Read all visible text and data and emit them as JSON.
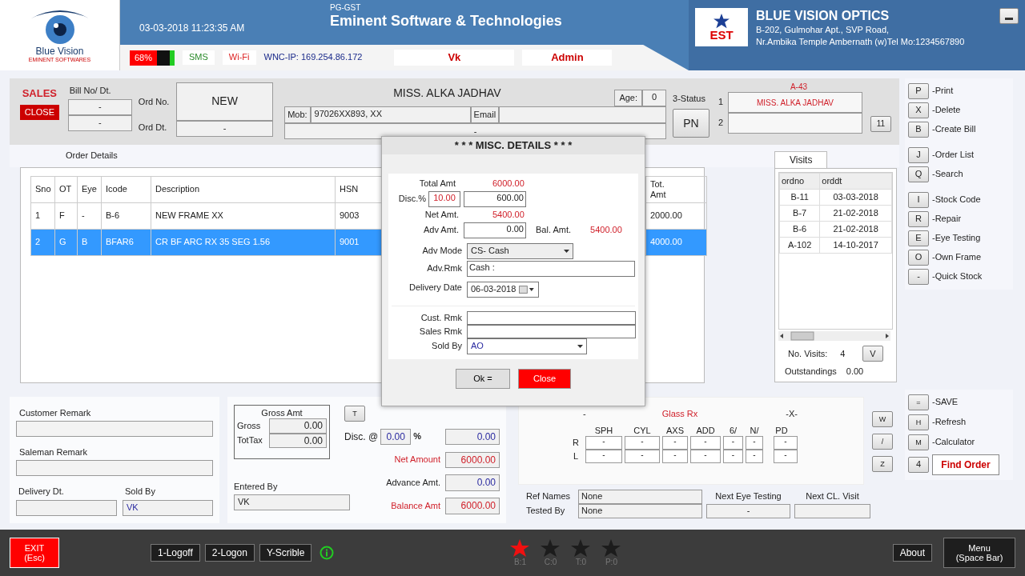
{
  "header": {
    "logo_text": "Blue Vision",
    "logo_subtext": "EMINENT SOFTWARES",
    "datetime": "03-03-2018 11:23:35 AM",
    "product": "PG-GST",
    "company": "Eminent Software  & Technologies",
    "battery": {
      "label": "68%",
      "level": 0.68
    },
    "sms": "SMS",
    "wifi": "Wi-Fi",
    "ip": "WNC-IP: 169.254.86.172",
    "user": "Vk",
    "role": "Admin",
    "shop_logo": "EST",
    "shop_name": "BLUE VISION OPTICS",
    "address_1": "B-202, Gulmohar Apt., SVP Road,",
    "address_2": "Nr.Ambika Temple Ambernath (w)Tel Mo:1234567890"
  },
  "order": {
    "mode": "SALES",
    "close": "CLOSE",
    "bill_label": "Bill No/ Dt.",
    "bill_no": "-",
    "bill_dt": "-",
    "ord_no_label": "Ord No.",
    "ord_no": "NEW",
    "ord_dt_label": "Ord Dt.",
    "ord_dt": "-",
    "customer": "MISS.  ALKA JADHAV",
    "age_label": "Age:",
    "age": "0",
    "mob_label": "Mob:",
    "mob": "97026XX893, XX",
    "email_label": "Email",
    "address": "-",
    "status_label": "3-Status",
    "status": "PN",
    "ref_code": "A-43",
    "slot_1": "1",
    "slot_1_value": "MISS.  ALKA JADHAV",
    "slot_2": "2",
    "count": "11"
  },
  "order_details_label": "Order Details",
  "items": {
    "columns": [
      "Sno",
      "OT",
      "Eye",
      "Icode",
      "Description",
      "HSN",
      "Tot. Amt"
    ],
    "rows": [
      {
        "cells": [
          "1",
          "F",
          "-",
          "B-6",
          "NEW FRAME XX",
          "9003",
          "2000.00"
        ],
        "selected": false
      },
      {
        "cells": [
          "2",
          "G",
          "B",
          "BFAR6",
          "CR BF ARC RX 35 SEG 1.56",
          "9001",
          "4000.00"
        ],
        "selected": true
      }
    ]
  },
  "visits": {
    "tab": "Visits",
    "columns": [
      "ordno",
      "orddt"
    ],
    "rows": [
      [
        "B-11",
        "03-03-2018"
      ],
      [
        "B-7",
        "21-02-2018"
      ],
      [
        "B-6",
        "21-02-2018"
      ],
      [
        "A-102",
        "14-10-2017"
      ]
    ],
    "count_label": "No. Visits:",
    "count": "4",
    "button": "V",
    "outstanding_label": "Outstandings",
    "outstanding": "0.00"
  },
  "shortcut_groups": [
    [
      {
        "key": "P",
        "label": "-Print"
      },
      {
        "key": "X",
        "label": "-Delete"
      },
      {
        "key": "B",
        "label": "-Create Bill"
      }
    ],
    [
      {
        "key": "J",
        "label": "-Order List"
      },
      {
        "key": "Q",
        "label": "-Search"
      }
    ],
    [
      {
        "key": "I",
        "label": "-Stock Code"
      },
      {
        "key": "R",
        "label": "-Repair"
      },
      {
        "key": "E",
        "label": "-Eye Testing"
      },
      {
        "key": "O",
        "label": "-Own Frame"
      },
      {
        "key": "-",
        "label": "-Quick Stock"
      }
    ]
  ],
  "remarks": {
    "customer_remark_label": "Customer Remark",
    "saleman_remark_label": "Saleman Remark",
    "delivery_label": "Delivery Dt.",
    "sold_by_label": "Sold By",
    "sold_by": "VK"
  },
  "amounts": {
    "gross_title": "Gross Amt",
    "gross_label": "Gross",
    "gross": "0.00",
    "tottax_label": "TotTax",
    "tottax": "0.00",
    "t_button": "T",
    "disc_label": "Disc. @",
    "disc_pct": "0.00",
    "pct": "%",
    "disc_amt": "0.00",
    "net_label": "Net Amount",
    "net": "6000.00",
    "advance_label": "Advance Amt.",
    "advance": "0.00",
    "balance_label": "Balance Amt",
    "balance": "6000.00",
    "entered_by_label": "Entered  By",
    "entered_by": "VK"
  },
  "rx": {
    "dash": "-",
    "title": "Glass Rx",
    "x_mark": "-X-",
    "columns": [
      "SPH",
      "CYL",
      "AXS",
      "ADD",
      "6/",
      "N/",
      "PD"
    ],
    "rows": [
      {
        "eye": "R",
        "values": [
          "-",
          "-",
          "-",
          "-",
          "-",
          "-",
          "-"
        ]
      },
      {
        "eye": "L",
        "values": [
          "-",
          "-",
          "-",
          "-",
          "-",
          "-",
          "-"
        ]
      }
    ],
    "side_buttons": [
      "W",
      "/",
      "Z"
    ],
    "ref_label": "Ref Names",
    "ref": "None",
    "tested_label": "Tested By",
    "tested": "None",
    "next_eye_label": "Next Eye Testing",
    "next_eye": "-",
    "next_cl_label": "Next CL. Visit"
  },
  "save_shortcuts": [
    {
      "key": "=",
      "label": "-SAVE"
    },
    {
      "key": "H",
      "label": "-Refresh"
    },
    {
      "key": "M",
      "label": "-Calculator"
    }
  ],
  "find": {
    "key": "4",
    "label": "Find Order"
  },
  "dialog": {
    "title": "* * *  MISC. DETAILS  * * *",
    "total_label": "Total Amt",
    "total": "6000.00",
    "disc_label": "Disc.%",
    "disc_pct": "10.00",
    "disc_amt": "600.00",
    "net_label": "Net Amt.",
    "net": "5400.00",
    "adv_label": "Adv Amt.",
    "adv": "0.00",
    "bal_label": "Bal. Amt.",
    "bal": "5400.00",
    "mode_label": "Adv Mode",
    "mode": "CS- Cash",
    "rmk_label": "Adv.Rmk",
    "rmk": "Cash :",
    "delivery_label": "Delivery Date",
    "delivery": "06-03-2018",
    "cust_rmk_label": "Cust. Rmk",
    "sales_rmk_label": "Sales Rmk",
    "sold_by_label": "Sold By",
    "sold_by": "AO",
    "ok": "Ok =",
    "close": "Close"
  },
  "footer": {
    "exit": [
      "EXIT",
      "(Esc)"
    ],
    "buttons": [
      "1-Logoff",
      "2-Logon",
      "Y-Scrible"
    ],
    "stars": [
      {
        "label": "B:1",
        "on": true
      },
      {
        "label": "C:0",
        "on": false
      },
      {
        "label": "T:0",
        "on": false
      },
      {
        "label": "P:0",
        "on": false
      }
    ],
    "about": "About",
    "menu": [
      "Menu",
      "(Space Bar)"
    ]
  }
}
